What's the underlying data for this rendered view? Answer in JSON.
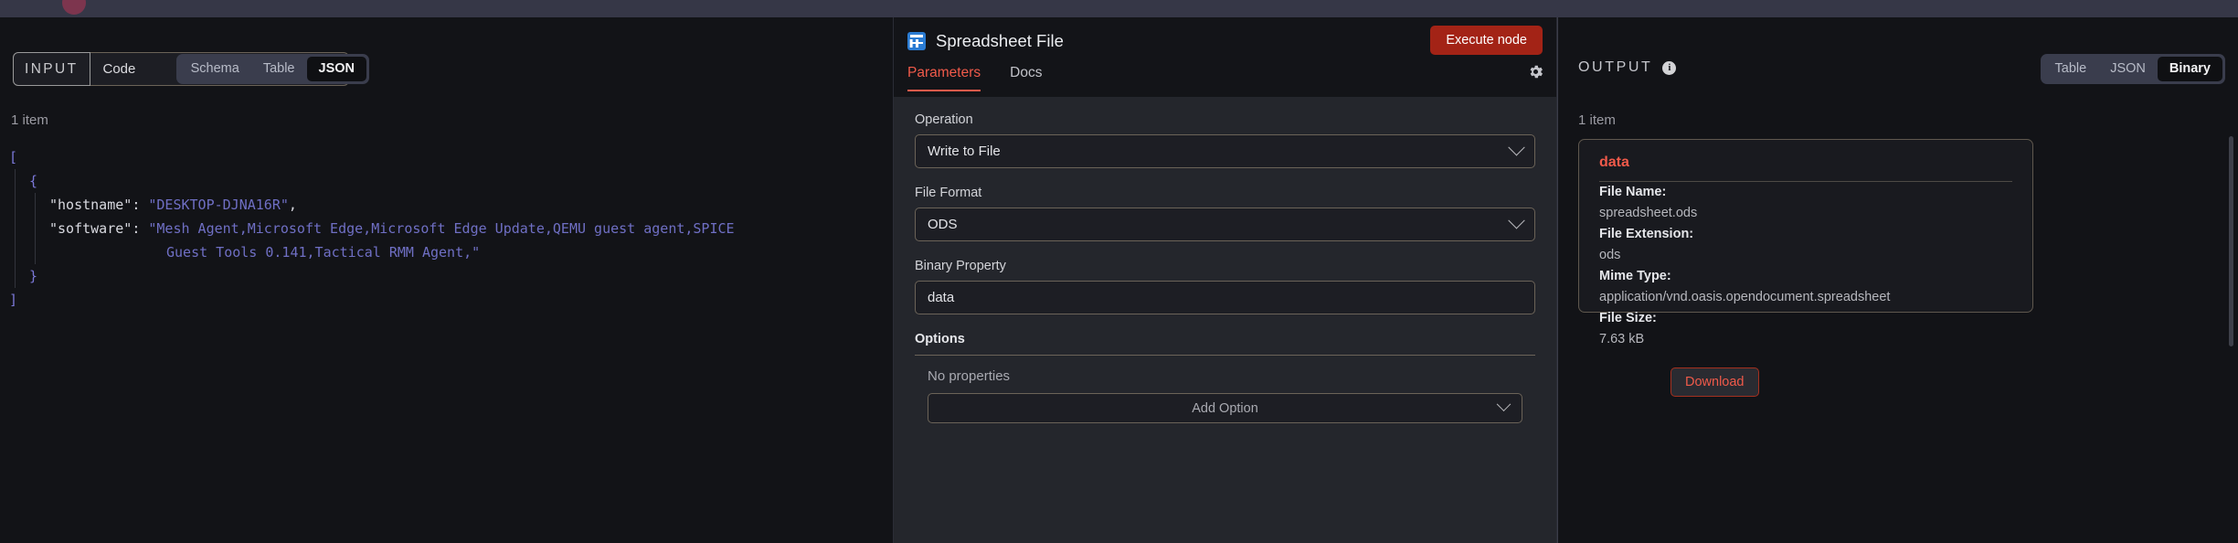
{
  "input": {
    "badge_label": "INPUT",
    "source_select_value": "Code",
    "view_tabs": [
      {
        "label": "Schema",
        "active": false
      },
      {
        "label": "Table",
        "active": false
      },
      {
        "label": "JSON",
        "active": true
      }
    ],
    "item_count": "1 item",
    "json_lines": [
      {
        "indent": 0,
        "parts": [
          {
            "t": "brace",
            "s": "["
          }
        ]
      },
      {
        "indent": 1,
        "parts": [
          {
            "t": "brace",
            "s": "{"
          }
        ]
      },
      {
        "indent": 2,
        "parts": [
          {
            "t": "key",
            "s": "\"hostname\""
          },
          {
            "t": "punc",
            "s": ": "
          },
          {
            "t": "str",
            "s": "\"DESKTOP-DJNA16R\""
          },
          {
            "t": "punc",
            "s": ","
          }
        ]
      },
      {
        "indent": 2,
        "parts": [
          {
            "t": "key",
            "s": "\"software\""
          },
          {
            "t": "punc",
            "s": ": "
          },
          {
            "t": "str",
            "s": "\"Mesh Agent,Microsoft Edge,Microsoft Edge Update,QEMU guest agent,SPICE"
          }
        ]
      },
      {
        "indent": 99,
        "parts": [
          {
            "t": "str",
            "s": "Guest Tools 0.141,Tactical RMM Agent,\""
          }
        ]
      },
      {
        "indent": 1,
        "parts": [
          {
            "t": "brace",
            "s": "}"
          }
        ]
      },
      {
        "indent": 0,
        "parts": [
          {
            "t": "brace",
            "s": "]"
          }
        ]
      }
    ]
  },
  "node": {
    "icon": "spreadsheet-icon",
    "title": "Spreadsheet File",
    "execute_label": "Execute node",
    "tabs": [
      {
        "label": "Parameters",
        "active": true
      },
      {
        "label": "Docs",
        "active": false
      }
    ],
    "settings_icon": "gear-icon",
    "fields": [
      {
        "label": "Operation",
        "value": "Write to File",
        "type": "select"
      },
      {
        "label": "File Format",
        "value": "ODS",
        "type": "select"
      },
      {
        "label": "Binary Property",
        "value": "data",
        "type": "text"
      }
    ],
    "options": {
      "header": "Options",
      "empty_text": "No properties",
      "add_label": "Add Option"
    }
  },
  "output": {
    "title": "OUTPUT",
    "info_icon": "info-icon",
    "view_tabs": [
      {
        "label": "Table",
        "active": false
      },
      {
        "label": "JSON",
        "active": false
      },
      {
        "label": "Binary",
        "active": true
      }
    ],
    "item_count": "1 item",
    "card": {
      "title": "data",
      "rows": [
        {
          "key": "File Name:",
          "value": "spreadsheet.ods"
        },
        {
          "key": "File Extension:",
          "value": "ods"
        },
        {
          "key": "Mime Type:",
          "value": "application/vnd.oasis.opendocument.spreadsheet"
        },
        {
          "key": "File Size:",
          "value": "7.63 kB"
        }
      ],
      "download_label": "Download"
    }
  },
  "colors": {
    "accent_red": "#f05a4a",
    "execute_red": "#a32316",
    "node_icon_blue": "#2b7cd3",
    "panel_bg": "#121317",
    "node_body_bg": "#24262c"
  }
}
